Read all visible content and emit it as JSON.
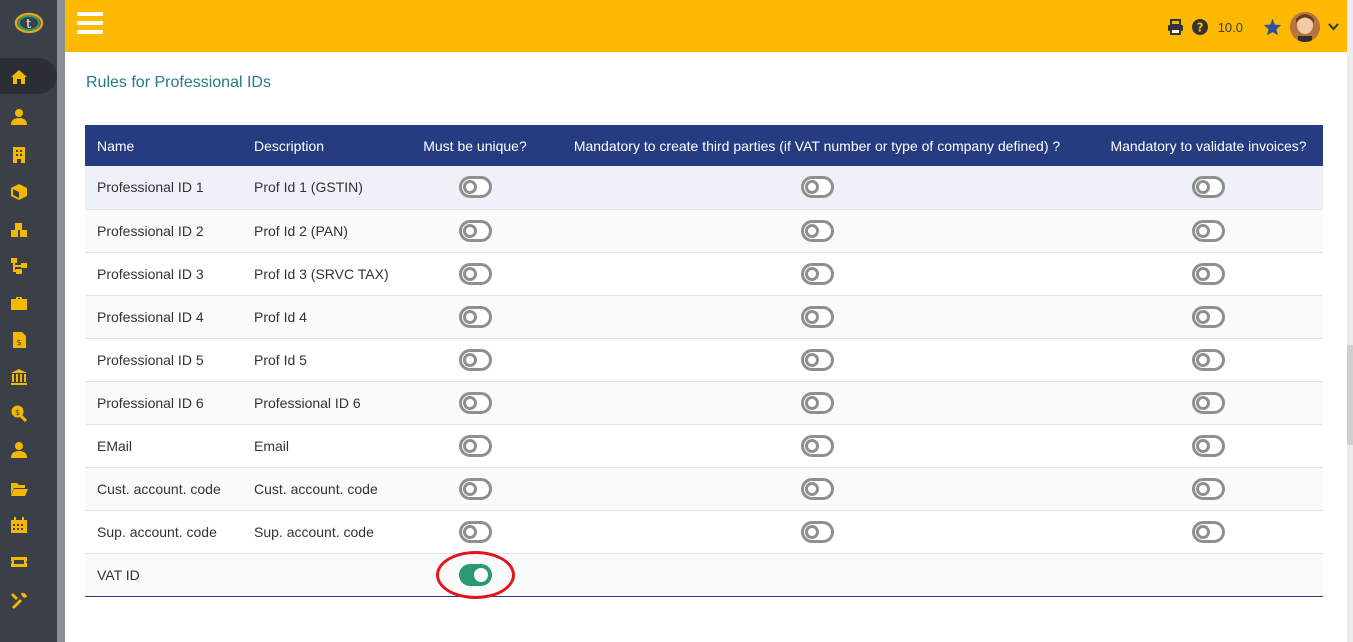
{
  "header": {
    "version": "10.0"
  },
  "page": {
    "title": "Rules for Professional IDs"
  },
  "table": {
    "columns": [
      "Name",
      "Description",
      "Must be unique?",
      "Mandatory to create third parties (if VAT number or type of company defined) ?",
      "Mandatory to validate invoices?"
    ],
    "rows": [
      {
        "name": "Professional ID 1",
        "description": "Prof Id 1 (GSTIN)",
        "unique": false,
        "mandatory_third": false,
        "mandatory_invoice": false
      },
      {
        "name": "Professional ID 2",
        "description": "Prof Id 2 (PAN)",
        "unique": false,
        "mandatory_third": false,
        "mandatory_invoice": false
      },
      {
        "name": "Professional ID 3",
        "description": "Prof Id 3 (SRVC TAX)",
        "unique": false,
        "mandatory_third": false,
        "mandatory_invoice": false
      },
      {
        "name": "Professional ID 4",
        "description": "Prof Id 4",
        "unique": false,
        "mandatory_third": false,
        "mandatory_invoice": false
      },
      {
        "name": "Professional ID 5",
        "description": "Prof Id 5",
        "unique": false,
        "mandatory_third": false,
        "mandatory_invoice": false
      },
      {
        "name": "Professional ID 6",
        "description": "Professional ID 6",
        "unique": false,
        "mandatory_third": false,
        "mandatory_invoice": false
      },
      {
        "name": "EMail",
        "description": "Email",
        "unique": false,
        "mandatory_third": false,
        "mandatory_invoice": false
      },
      {
        "name": "Cust. account. code",
        "description": "Cust. account. code",
        "unique": false,
        "mandatory_third": false,
        "mandatory_invoice": false
      },
      {
        "name": "Sup. account. code",
        "description": "Sup. account. code",
        "unique": false,
        "mandatory_third": false,
        "mandatory_invoice": false
      },
      {
        "name": "VAT ID",
        "description": "",
        "unique": true,
        "mandatory_third": null,
        "mandatory_invoice": null
      }
    ]
  },
  "sidebar": {
    "icons": [
      "home-icon",
      "user-icon",
      "building-icon",
      "box-icon",
      "boxes-icon",
      "sitemap-icon",
      "briefcase-icon",
      "invoice-icon",
      "bank-icon",
      "search-dollar-icon",
      "users-icon",
      "folder-open-icon",
      "calendar-icon",
      "ticket-icon",
      "tools-icon"
    ]
  },
  "colors": {
    "topbar": "#fdb900",
    "sidebar": "#3b3f48",
    "table_header": "#263c81",
    "title": "#227b85",
    "toggle_on": "#2a9a73",
    "highlight": "#e3141b"
  }
}
